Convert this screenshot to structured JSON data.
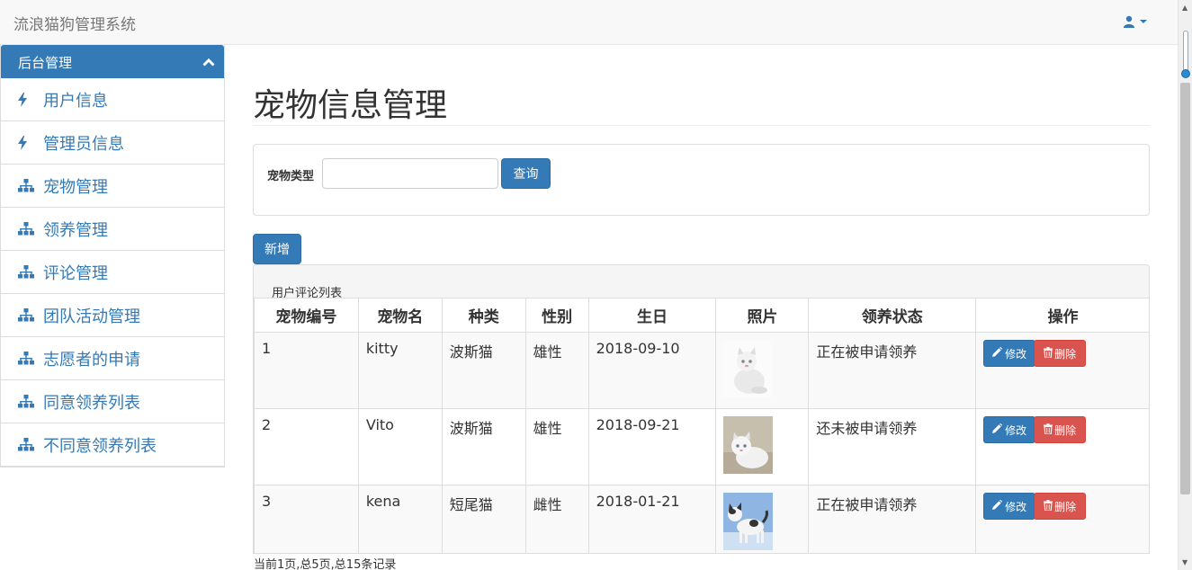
{
  "navbar": {
    "brand": "流浪猫狗管理系统",
    "user_icon": "user-icon",
    "caret_icon": "caret-down-icon"
  },
  "sidebar": {
    "header": "后台管理",
    "items": [
      {
        "label": "用户信息",
        "icon": "bolt-icon"
      },
      {
        "label": "管理员信息",
        "icon": "bolt-icon"
      },
      {
        "label": "宠物管理",
        "icon": "sitemap-icon"
      },
      {
        "label": "领养管理",
        "icon": "sitemap-icon"
      },
      {
        "label": "评论管理",
        "icon": "sitemap-icon"
      },
      {
        "label": "团队活动管理",
        "icon": "sitemap-icon"
      },
      {
        "label": "志愿者的申请",
        "icon": "sitemap-icon"
      },
      {
        "label": "同意领养列表",
        "icon": "sitemap-icon"
      },
      {
        "label": "不同意领养列表",
        "icon": "sitemap-icon"
      }
    ]
  },
  "main": {
    "title": "宠物信息管理",
    "search": {
      "label": "宠物类型",
      "value": "",
      "button": "查询"
    },
    "add_button": "新增",
    "table": {
      "caption": "用户评论列表",
      "headers": [
        "宠物编号",
        "宠物名",
        "种类",
        "性别",
        "生日",
        "照片",
        "领养状态",
        "操作"
      ],
      "rows": [
        {
          "id": "1",
          "name": "kitty",
          "kind": "波斯猫",
          "sex": "雄性",
          "birthday": "2018-09-10",
          "status": "正在被申请领养"
        },
        {
          "id": "2",
          "name": "Vito",
          "kind": "波斯猫",
          "sex": "雄性",
          "birthday": "2018-09-21",
          "status": "还未被申请领养"
        },
        {
          "id": "3",
          "name": "kena",
          "kind": "短尾猫",
          "sex": "雌性",
          "birthday": "2018-01-21",
          "status": "正在被申请领养"
        }
      ],
      "edit_label": "修改",
      "delete_label": "删除"
    },
    "pagination": "当前1页,总5页,总15条记录"
  },
  "colors": {
    "primary": "#337ab7",
    "danger": "#d9534f",
    "navbar_bg": "#f8f8f8"
  }
}
